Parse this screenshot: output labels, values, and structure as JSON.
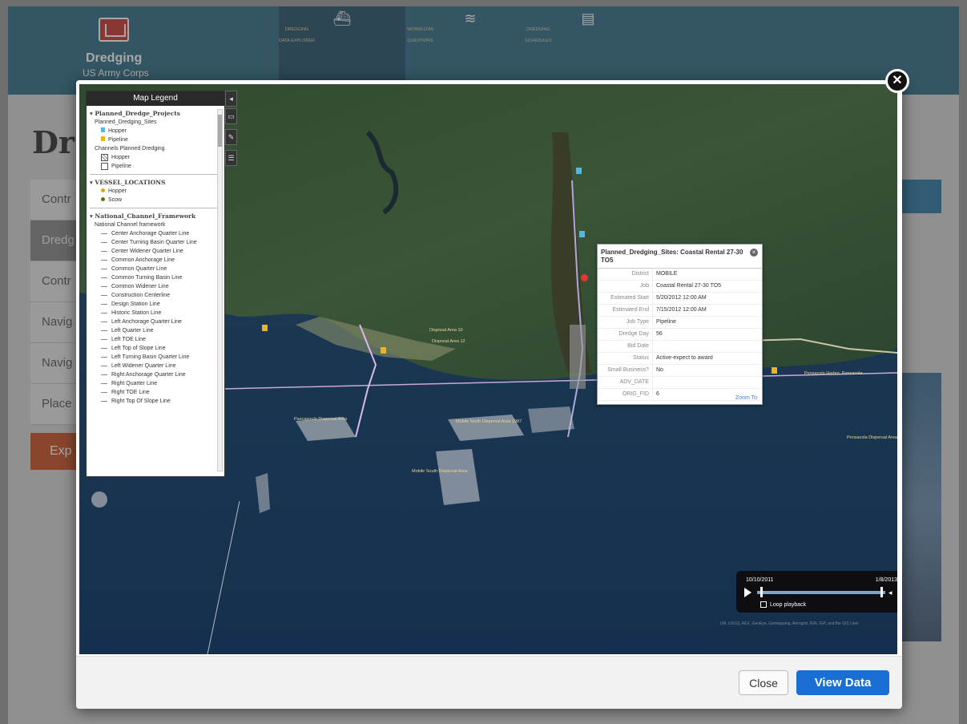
{
  "site": {
    "logo_title": "Dredging",
    "logo_subtitle": "US Army Corps",
    "nav": [
      {
        "label1": "DREDGING",
        "label2": "DATA EXPLORER"
      },
      {
        "label1": "WORKFLOW",
        "label2": "QUESTIONS"
      },
      {
        "label1": "DREDGING",
        "label2": "SCHEDULES"
      }
    ],
    "page_title": "Dr",
    "sidebar": [
      "Contr",
      "Dredg",
      "Contr",
      "Navig",
      "Navig",
      "Place"
    ],
    "export_label": "Exp"
  },
  "legend": {
    "title": "Map Legend",
    "group1": "▾ Planned_Dredge_Projects",
    "sites": "Planned_Dredging_Sites",
    "hopper": "Hopper",
    "pipeline": "Pipeline",
    "channels": "Channels Planned Dredging",
    "group2": "▾ VESSEL_LOCATIONS",
    "v_hopper": "Hopper",
    "v_scow": "Scow",
    "group3": "▾ National_Channel_Framework",
    "ncf": "National Channel framework",
    "lines": [
      "Center Anchorage Quarter Line",
      "Center Turning Basin Quarter Line",
      "Center Widener Quarter Line",
      "Common Anchorage Line",
      "Common Quarter Line",
      "Common Turning Basin Line",
      "Common Widener Line",
      "Construction Centerline",
      "Design Station Line",
      "Historic Station Line",
      "Left Anchorage Quarter Line",
      "Left Quarter Line",
      "Left TOE Line",
      "Left Top of Slope Line",
      "Left Turning Basin Quarter Line",
      "Left Widener Quarter Line",
      "Right Anchorage Quarter Line",
      "Right Quarter Line",
      "Right TOE Line",
      "Right Top Of Slope Line"
    ]
  },
  "popup": {
    "title": "Planned_Dredging_Sites: Coastal Rental 27-30 TO5",
    "fields": [
      {
        "k": "District",
        "v": "MOBILE"
      },
      {
        "k": "Job",
        "v": "Coastal Rental 27-30 TO5"
      },
      {
        "k": "Estimated Start",
        "v": "5/20/2012 12:00 AM"
      },
      {
        "k": "Estimated End",
        "v": "7/15/2012 12:00 AM"
      },
      {
        "k": "Job Type",
        "v": "Pipeline"
      },
      {
        "k": "Dredge Day",
        "v": "56"
      },
      {
        "k": "Bid Date",
        "v": ""
      },
      {
        "k": "Status",
        "v": "Active-expect to award"
      },
      {
        "k": "Small Business?",
        "v": "No"
      },
      {
        "k": "ADV_DATE",
        "v": ""
      },
      {
        "k": "ORIG_FID",
        "v": "6"
      }
    ],
    "zoom": "Zoom To"
  },
  "timeslider": {
    "start": "10/10/2011",
    "end": "1/8/2013",
    "loop": "Loop playback"
  },
  "map_labels": [
    "Mobile North Dispersal Area 1987",
    "Pascagoula Dispersal Area",
    "Mobile South Dispersal Area",
    "Pensacola Harbor, Pensacola",
    "Pensacola Dispersal Area",
    "Disposal Area 10",
    "Disposal Area 12"
  ],
  "attribution": "i3A, USGS, AEX, GeoEye, Getmapping, Aerogrid, IGN, IGP, and the GIS User",
  "buttons": {
    "close": "Close",
    "view": "View Data"
  }
}
